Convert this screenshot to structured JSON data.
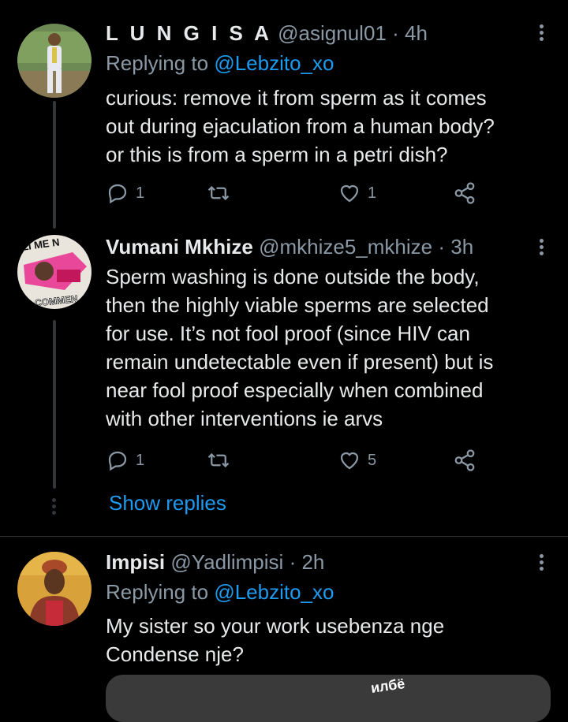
{
  "tweets": [
    {
      "name": "L U N G I S A",
      "handle": "@asignul01",
      "sep": "·",
      "time": "4h",
      "replying_label": "Replying to",
      "replying_to": "@Lebzito_xo",
      "text": "curious:  remove it from sperm as it comes\nout during ejaculation from a human body?\nor this is from a sperm in a petri dish?",
      "replies": "1",
      "retweets": "",
      "likes": "1"
    },
    {
      "name": "Vumani Mkhize",
      "handle": "@mkhize5_mkhize",
      "sep": "·",
      "time": "3h",
      "avatar_text_top": "LI ME N",
      "avatar_text_bottom": "COMMEN",
      "text": "Sperm washing is done outside the body,\nthen the highly viable sperms are selected\nfor use. It’s not fool proof (since HIV can\nremain undetectable even if present) but is\nnear fool proof especially when combined\nwith other interventions ie arvs",
      "replies": "1",
      "retweets": "",
      "likes": "5"
    },
    {
      "name": "Impisi",
      "handle": "@Yadlimpisi",
      "sep": "·",
      "time": "2h",
      "replying_label": "Replying to",
      "replying_to": "@Lebzito_xo",
      "text": "My sister so your work usebenza nge\nCondense  nje?",
      "media_text": "илбё"
    }
  ],
  "thread": {
    "show_replies_label": "Show replies"
  },
  "icons": [
    "reply-icon",
    "retweet-icon",
    "like-icon",
    "share-icon",
    "more-icon"
  ],
  "colors": {
    "background": "#000000",
    "text": "#e7e9ea",
    "muted": "#8b98a5",
    "link": "#1d9bf0"
  }
}
